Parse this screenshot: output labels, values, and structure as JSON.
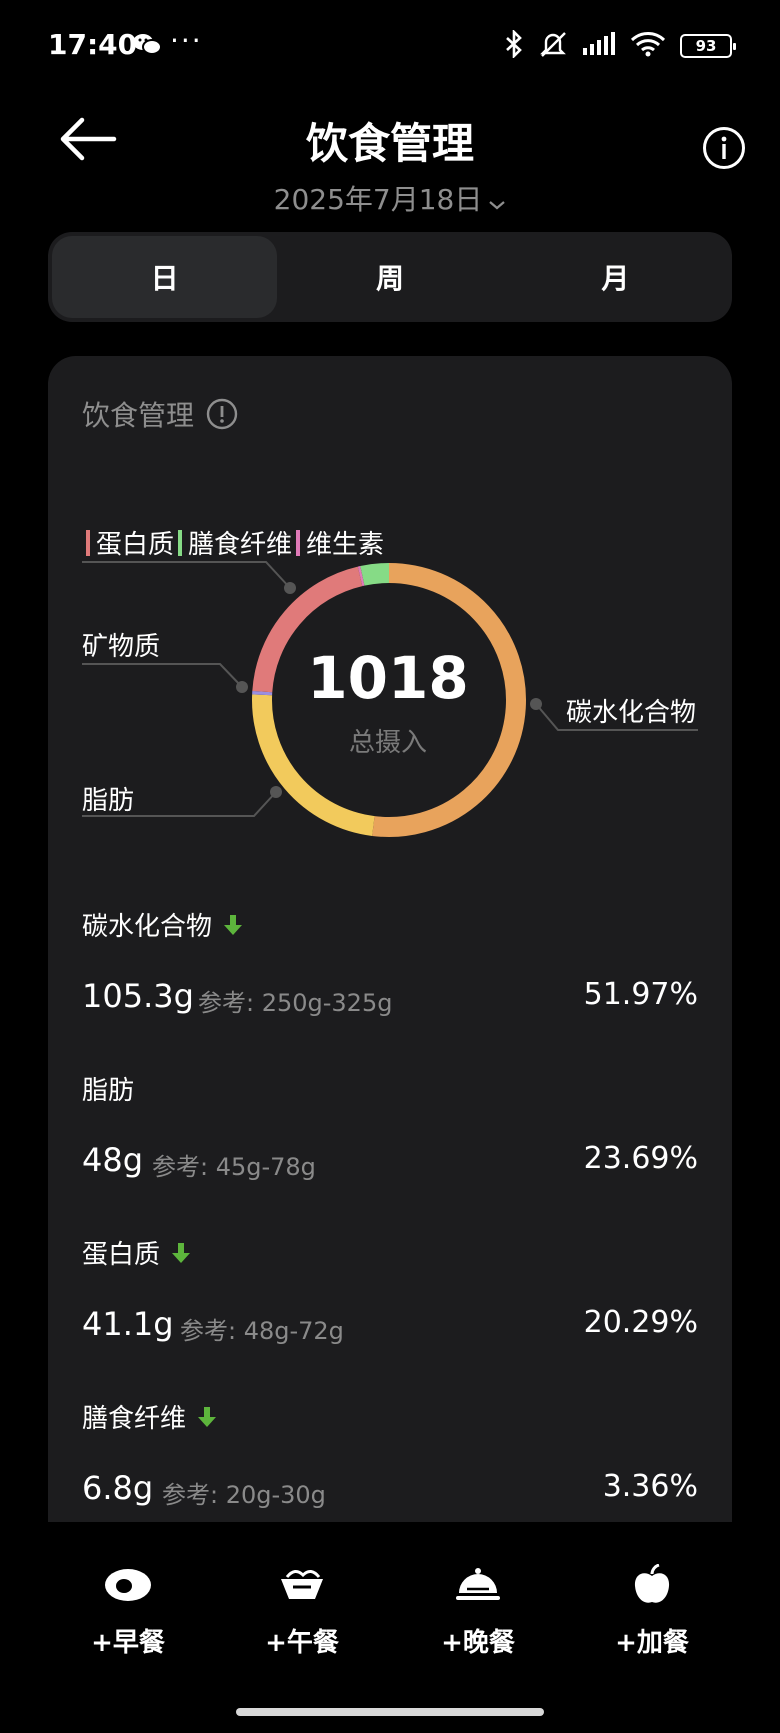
{
  "status": {
    "time": "17:40",
    "dots": "···",
    "battery": "93"
  },
  "header": {
    "title": "饮食管理",
    "date": "2025年7月18日"
  },
  "tabs": [
    {
      "label": "日",
      "active": true
    },
    {
      "label": "周",
      "active": false
    },
    {
      "label": "月",
      "active": false
    }
  ],
  "card": {
    "title": "饮食管理",
    "chart_data": {
      "type": "pie",
      "center_value": "1018",
      "center_label": "总摄入",
      "slices": [
        {
          "name": "碳水化合物",
          "percent": 51.97,
          "color": "#E8A35C"
        },
        {
          "name": "脂肪",
          "percent": 23.69,
          "color": "#F2CA5C"
        },
        {
          "name": "矿物质",
          "percent": 0.4,
          "color": "#9B8FE0"
        },
        {
          "name": "蛋白质",
          "percent": 20.29,
          "color": "#E07A7A"
        },
        {
          "name": "维生素",
          "percent": 0.3,
          "color": "#E07AB8"
        },
        {
          "name": "膳食纤维",
          "percent": 3.36,
          "color": "#86DB86"
        }
      ],
      "legend": [
        {
          "name": "蛋白质",
          "color": "#E07A7A"
        },
        {
          "name": "膳食纤维",
          "color": "#86DB86"
        },
        {
          "name": "维生素",
          "color": "#E07AB8"
        }
      ]
    },
    "labels": {
      "mineral": "矿物质",
      "fat": "脂肪",
      "carbs": "碳水化合物"
    },
    "nutrients": [
      {
        "name": "碳水化合物",
        "amount": "105.3g",
        "ref": "参考: 250g-325g",
        "percent": "51.97%",
        "low": true
      },
      {
        "name": "脂肪",
        "amount": "48g",
        "ref": "参考: 45g-78g",
        "percent": "23.69%",
        "low": false
      },
      {
        "name": "蛋白质",
        "amount": "41.1g",
        "ref": "参考: 48g-72g",
        "percent": "20.29%",
        "low": true
      },
      {
        "name": "膳食纤维",
        "amount": "6.8g",
        "ref": "参考: 20g-30g",
        "percent": "3.36%",
        "low": true
      }
    ]
  },
  "bottom_nav": [
    {
      "label": "+早餐",
      "icon": "egg-icon"
    },
    {
      "label": "+午餐",
      "icon": "bowl-icon"
    },
    {
      "label": "+晚餐",
      "icon": "cloche-icon"
    },
    {
      "label": "+加餐",
      "icon": "apple-icon"
    }
  ]
}
